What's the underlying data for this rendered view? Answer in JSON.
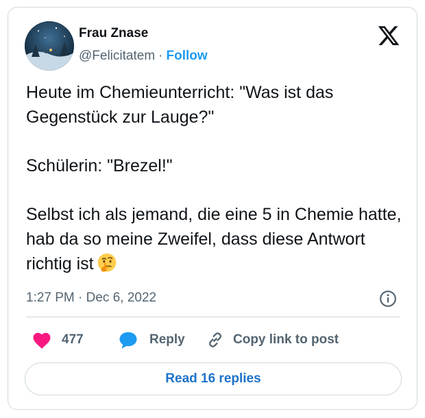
{
  "author": {
    "name": "Frau Znase",
    "handle": "@Felicitatem",
    "separator": "·",
    "follow_label": "Follow",
    "avatar_icon": "night-winter-scene-avatar"
  },
  "platform": {
    "logo_icon": "x-logo-icon"
  },
  "tweet": {
    "paragraphs": [
      "Heute im Chemieunterricht: \"Was ist das Gegenstück zur Lauge?\"",
      "Schülerin: \"Brezel!\"",
      "Selbst ich als jemand, die eine 5 in Chemie hatte, hab da so meine Zweifel, dass diese Antwort richtig ist"
    ],
    "trailing_emoji": "thinking-face-emoji",
    "timestamp": "1:27 PM · Dec 6, 2022"
  },
  "actions": {
    "like_count": "477",
    "reply_label": "Reply",
    "copy_link_label": "Copy link to post"
  },
  "footer": {
    "read_replies_label": "Read 16 replies"
  },
  "colors": {
    "accent": "#1d9bf0",
    "like": "#f91880",
    "muted_text": "#536471",
    "border": "#cfd9de"
  }
}
